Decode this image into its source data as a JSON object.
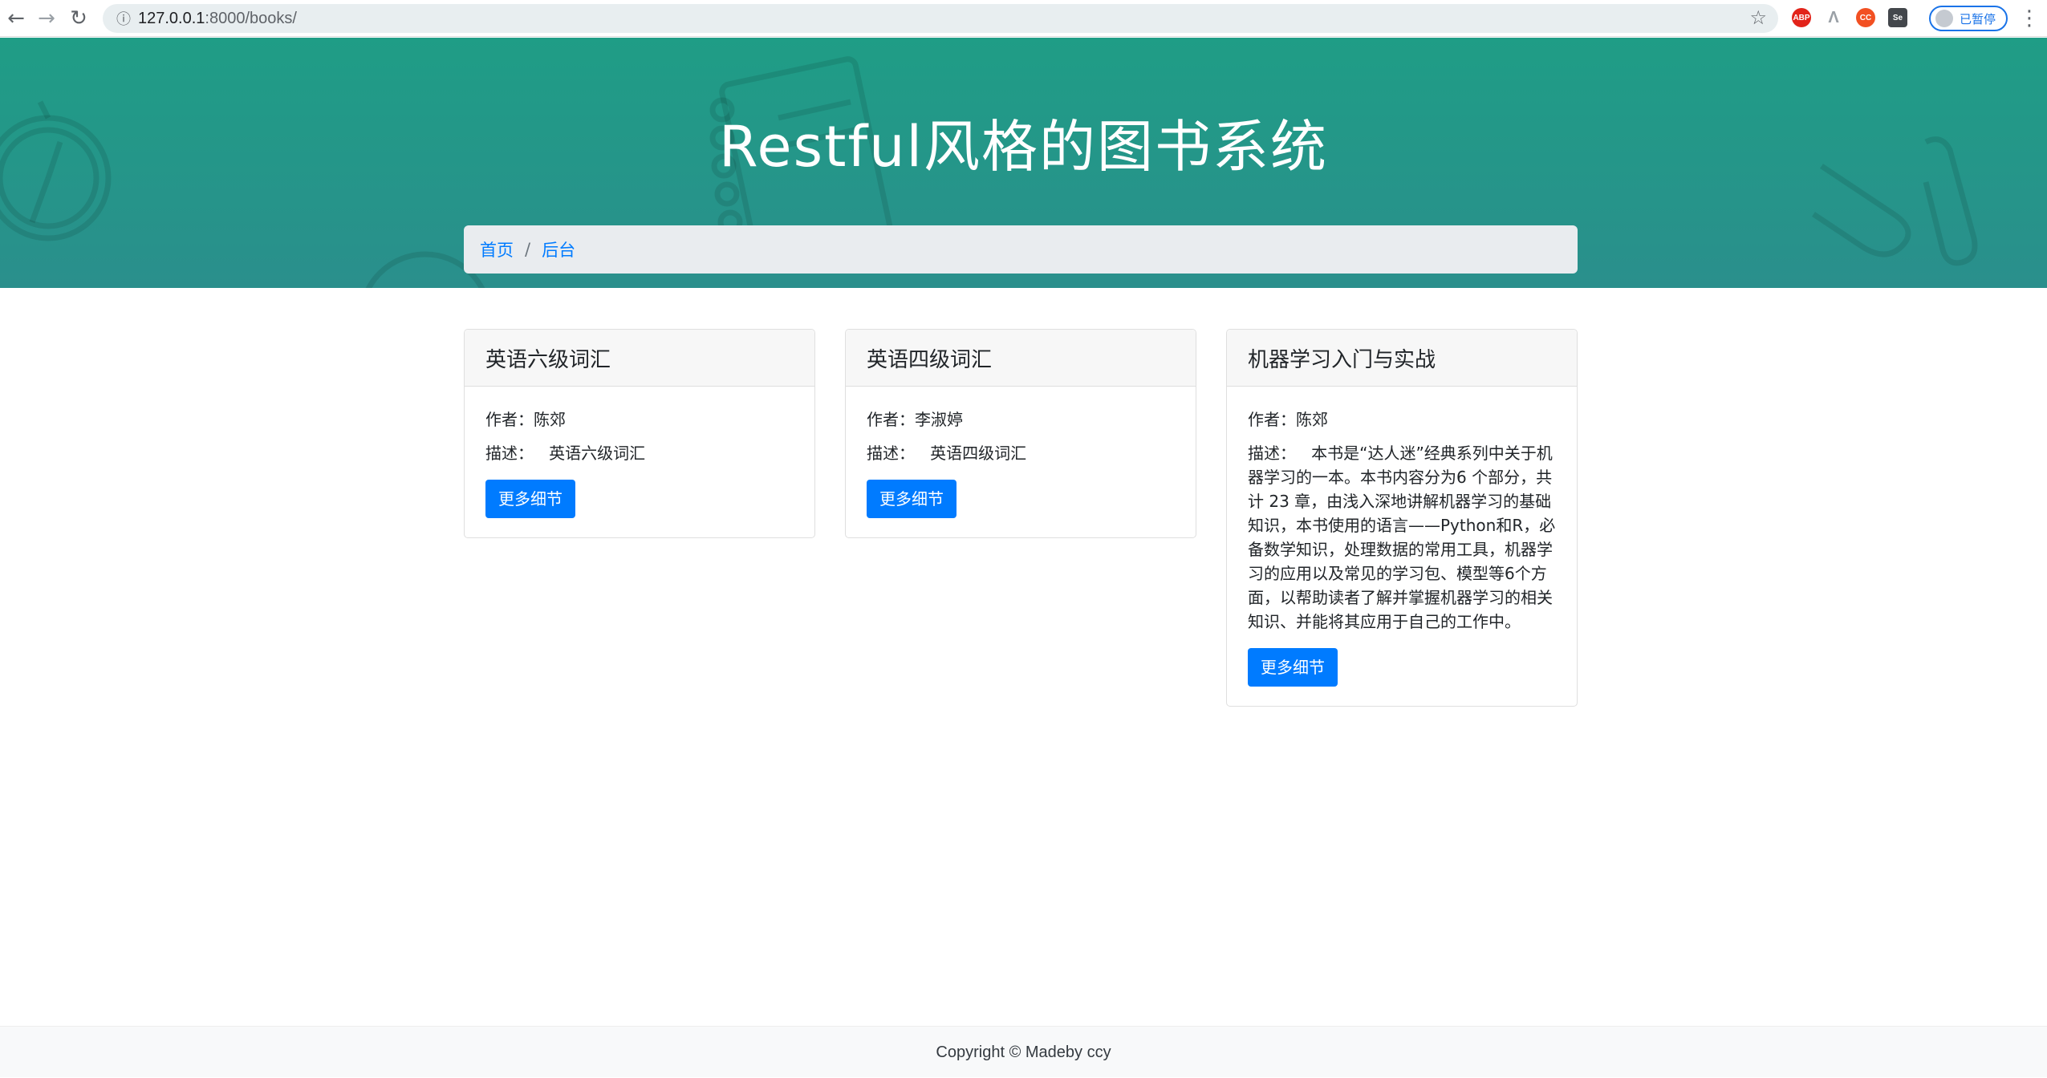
{
  "browser": {
    "url_host": "127.0.0.1",
    "url_path": ":8000/books/",
    "profile_label": "已暂停",
    "ext_abp": "ABP",
    "ext_cc": "CC",
    "ext_se": "Se"
  },
  "hero": {
    "title": "Restful风格的图书系统"
  },
  "breadcrumb": {
    "items": [
      {
        "label": "首页"
      },
      {
        "label": "后台"
      }
    ],
    "separator": "/"
  },
  "cards": [
    {
      "title": "英语六级词汇",
      "author_label": "作者：",
      "author": "陈郊",
      "desc_label": "描述：",
      "desc": "英语六级词汇",
      "button_label": "更多细节"
    },
    {
      "title": "英语四级词汇",
      "author_label": "作者：",
      "author": "李淑婷",
      "desc_label": "描述：",
      "desc": "英语四级词汇",
      "button_label": "更多细节"
    },
    {
      "title": "机器学习入门与实战",
      "author_label": "作者：",
      "author": "陈郊",
      "desc_label": "描述：",
      "desc": "本书是“达人迷”经典系列中关于机器学习的一本。本书内容分为6 个部分，共计 23 章，由浅入深地讲解机器学习的基础知识，本书使用的语言——Python和R，必备数学知识，处理数据的常用工具，机器学习的应用以及常见的学习包、模型等6个方面，以帮助读者了解并掌握机器学习的相关知识、并能将其应用于自己的工作中。",
      "button_label": "更多细节"
    }
  ],
  "footer": {
    "text": "Copyright © Madeby ccy"
  }
}
